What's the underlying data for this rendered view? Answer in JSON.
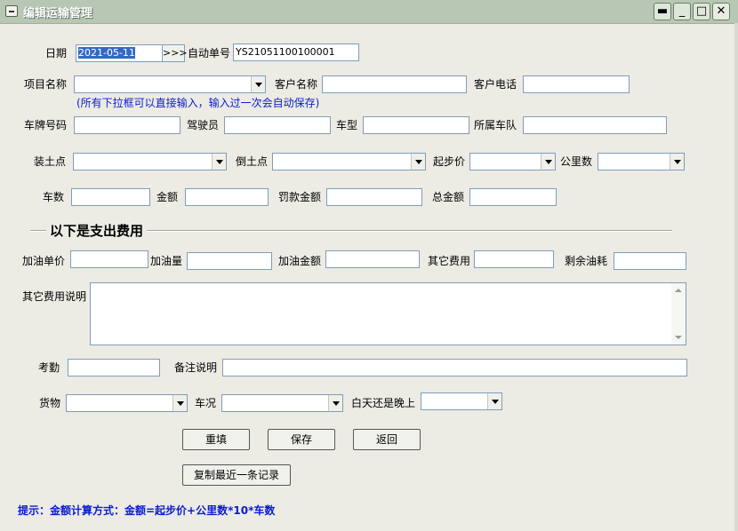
{
  "window": {
    "title": "编辑运输管理"
  },
  "fields": {
    "date_label": "日期",
    "date_value": "2021-05-11",
    "date_btn": ">>>",
    "order_no_label": "自动单号",
    "order_no_value": "YS21051100100001",
    "project_label": "项目名称",
    "customer_label": "客户名称",
    "phone_label": "客户电话",
    "project_hint": "(所有下拉框可以直接输入，输入过一次会自动保存)",
    "plate_label": "车牌号码",
    "driver_label": "驾驶员",
    "vehicle_type_label": "车型",
    "fleet_label": "所属车队",
    "load_point_label": "装土点",
    "dump_point_label": "倒土点",
    "start_price_label": "起步价",
    "km_label": "公里数",
    "trucks_label": "车数",
    "amount_label": "金额",
    "penalty_label": "罚款金额",
    "total_label": "总金额"
  },
  "expense": {
    "section_title": "以下是支出费用",
    "fuel_price_label": "加油单价",
    "fuel_qty_label": "加油量",
    "fuel_amount_label": "加油金额",
    "other_fee_label": "其它费用",
    "remaining_fuel_label": "剩余油耗",
    "other_desc_label": "其它费用说明",
    "attendance_label": "考勤",
    "remark_label": "备注说明",
    "cargo_label": "货物",
    "vehicle_cond_label": "车况",
    "day_night_label": "白天还是晚上"
  },
  "buttons": {
    "reset": "重填",
    "save": "保存",
    "back": "返回",
    "copy_last": "复制最近一条记录"
  },
  "footer": {
    "tip": "提示：金额计算方式：金额=起步价+公里数*10*车数"
  },
  "colors": {
    "titlebar": "#b7c7b4",
    "background": "#ecebe4",
    "hint": "#0a1cd0",
    "selection": "#316ac5"
  }
}
